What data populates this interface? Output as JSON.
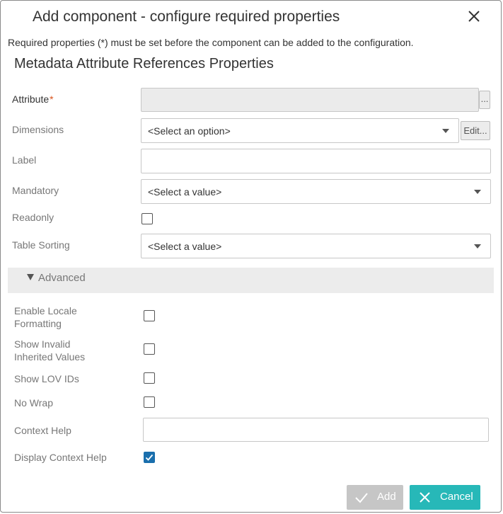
{
  "dialog": {
    "title": "Add component - configure required properties",
    "intro": "Required properties (*) must be set before the component can be added to the configuration.",
    "section_title": "Metadata Attribute References Properties"
  },
  "fields": {
    "attribute": {
      "label": "Attribute",
      "required_mark": "*",
      "value": "",
      "browse_label": "..."
    },
    "dimensions": {
      "label": "Dimensions",
      "value": "<Select an option>",
      "edit_label": "Edit..."
    },
    "label": {
      "label": "Label",
      "value": ""
    },
    "mandatory": {
      "label": "Mandatory",
      "value": "<Select a value>"
    },
    "readonly": {
      "label": "Readonly",
      "checked": false
    },
    "table_sorting": {
      "label": "Table Sorting",
      "value": "<Select a value>"
    }
  },
  "advanced": {
    "label": "Advanced",
    "expanded": true,
    "enable_locale_formatting": {
      "label_line1": "Enable Locale",
      "label_line2": "Formatting",
      "checked": false
    },
    "show_invalid_inherited": {
      "label_line1": "Show Invalid",
      "label_line2": "Inherited Values",
      "checked": false
    },
    "show_lov_ids": {
      "label": "Show LOV IDs",
      "checked": false
    },
    "no_wrap": {
      "label": "No Wrap",
      "checked": false
    },
    "context_help": {
      "label": "Context Help",
      "value": ""
    },
    "display_context_help": {
      "label": "Display Context Help",
      "checked": true
    }
  },
  "footer": {
    "add_label": "Add",
    "add_enabled": false,
    "cancel_label": "Cancel"
  },
  "colors": {
    "required_mark": "#d9541e",
    "checkbox_checked": "#1a6fad",
    "cancel_button": "#27b8b8",
    "add_button_disabled": "#c6c6c6"
  },
  "icons": {
    "close": "close-icon",
    "dropdown": "chevron-down-icon",
    "advanced_toggle": "triangle-down-icon",
    "add": "checkmark-icon",
    "cancel": "x-icon"
  }
}
